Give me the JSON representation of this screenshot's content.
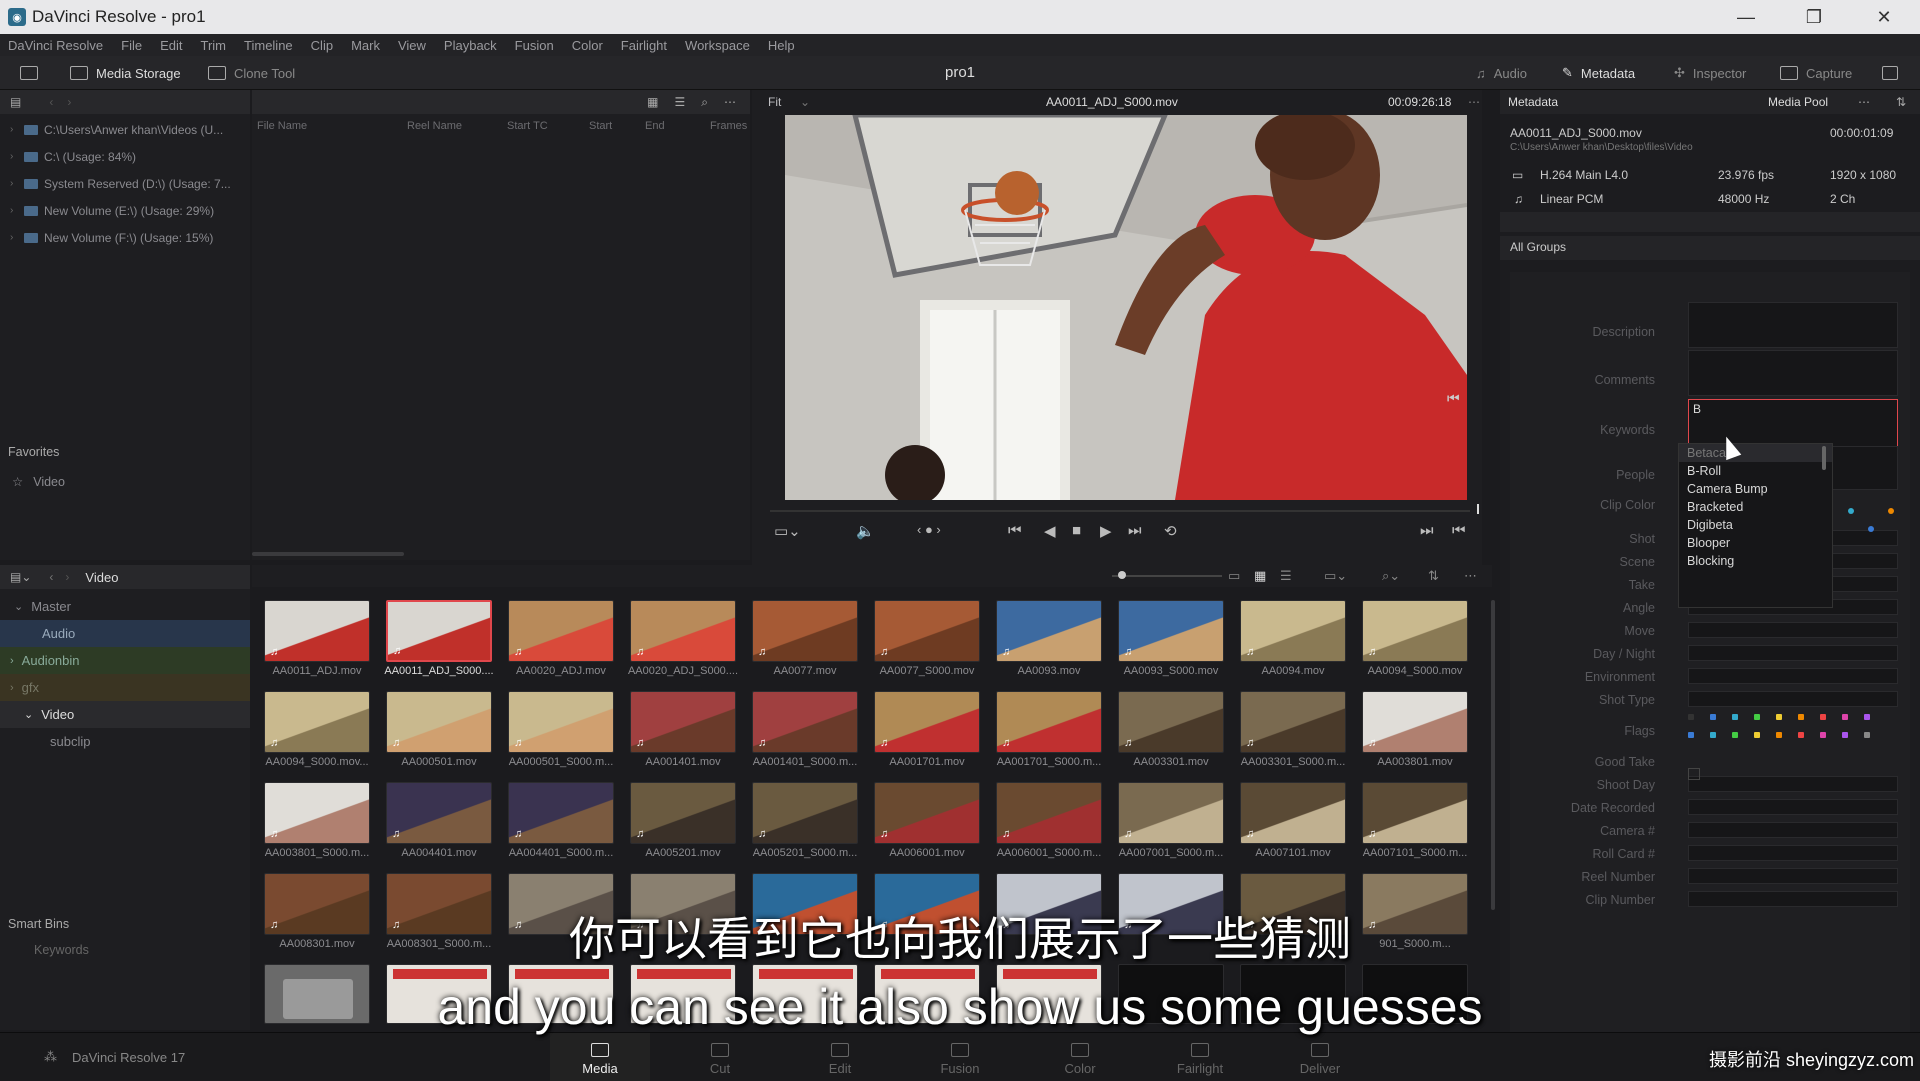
{
  "window": {
    "title": "DaVinci Resolve - pro1",
    "app_icon": "davinci-icon"
  },
  "menu": [
    "DaVinci Resolve",
    "File",
    "Edit",
    "Trim",
    "Timeline",
    "Clip",
    "Mark",
    "View",
    "Playback",
    "Fusion",
    "Color",
    "Fairlight",
    "Workspace",
    "Help"
  ],
  "toolbar": {
    "media_storage": "Media Storage",
    "clone_tool": "Clone Tool",
    "project": "pro1",
    "audio": "Audio",
    "metadata": "Metadata",
    "inspector": "Inspector",
    "capture": "Capture"
  },
  "storage": {
    "drives": [
      "C:\\Users\\Anwer khan\\Videos (U...",
      "C:\\ (Usage: 84%)",
      "System Reserved (D:\\) (Usage: 7...",
      "New Volume (E:\\) (Usage: 29%)",
      "New Volume (F:\\) (Usage: 15%)"
    ],
    "columns": [
      "File Name",
      "Reel Name",
      "Start TC",
      "Start",
      "End",
      "Frames"
    ],
    "favorites_title": "Favorites",
    "favorites": [
      "Video"
    ]
  },
  "viewer": {
    "zoom": "Fit",
    "clip": "AA0011_ADJ_S000.mov",
    "timecode": "00:09:26:18"
  },
  "metadata": {
    "title": "Metadata",
    "pool": "Media Pool",
    "file": "AA0011_ADJ_S000.mov",
    "duration": "00:00:01:09",
    "path": "C:\\Users\\Anwer khan\\Desktop\\files\\Video",
    "codec": "H.264 Main L4.0",
    "fps": "23.976 fps",
    "resolution": "1920 x 1080",
    "audio": "Linear PCM",
    "rate": "48000 Hz",
    "channels": "2 Ch",
    "group": "All Groups",
    "fields": [
      "Description",
      "Comments",
      "Keywords",
      "People",
      "Clip Color",
      "Shot",
      "Scene",
      "Take",
      "Angle",
      "Move",
      "Day / Night",
      "Environment",
      "Shot Type",
      "Flags",
      "Good Take",
      "Shoot Day",
      "Date Recorded",
      "Camera #",
      "Roll Card #",
      "Reel Number",
      "Clip Number"
    ],
    "keyword_input": "B",
    "keyword_suggestions": [
      "Betacam",
      "B-Roll",
      "Camera Bump",
      "Bracketed",
      "Digibeta",
      "Blooper",
      "Blocking"
    ]
  },
  "bins": {
    "current": "Video",
    "items": [
      "Master",
      "Audio",
      "Audionbin",
      "gfx",
      "Video",
      "subclip"
    ],
    "smart_title": "Smart Bins",
    "smart": [
      "Keywords"
    ]
  },
  "clips": [
    "AA0011_ADJ.mov",
    "AA0011_ADJ_S000....",
    "AA0020_ADJ.mov",
    "AA0020_ADJ_S000....",
    "AA0077.mov",
    "AA0077_S000.mov",
    "AA0093.mov",
    "AA0093_S000.mov",
    "AA0094.mov",
    "AA0094_S000.mov",
    "AA0094_S000.mov...",
    "AA000501.mov",
    "AA000501_S000.m...",
    "AA001401.mov",
    "AA001401_S000.m...",
    "AA001701.mov",
    "AA001701_S000.m...",
    "AA003301.mov",
    "AA003301_S000.m...",
    "AA003801.mov",
    "AA003801_S000.m...",
    "AA004401.mov",
    "AA004401_S000.m...",
    "AA005201.mov",
    "AA005201_S000.m...",
    "AA006001.mov",
    "AA006001_S000.m...",
    "AA007001_S000.m...",
    "AA007101.mov",
    "AA007101_S000.m...",
    "AA008301.mov",
    "AA008301_S000.m...",
    "",
    "",
    "",
    "",
    "",
    "",
    "",
    "901_S000.m..."
  ],
  "pages": [
    "Media",
    "Cut",
    "Edit",
    "Fusion",
    "Color",
    "Fairlight",
    "Deliver"
  ],
  "version": "DaVinci Resolve 17",
  "subtitles": {
    "zh": "你可以看到它也向我们展示了一些猜测",
    "en": "and you can see it also show us some guesses"
  },
  "watermark": "摄影前沿 sheyingzyz.com",
  "colors": {
    "accent": "#e0474c",
    "panel": "#1e1e21",
    "bg": "#1b1b1e"
  }
}
